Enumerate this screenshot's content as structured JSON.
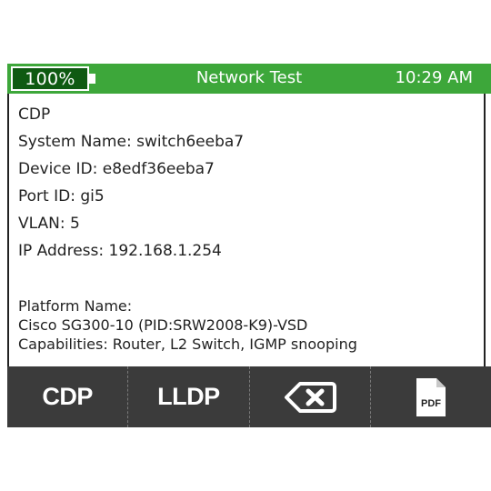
{
  "status_bar": {
    "battery": "100%",
    "title": "Network Test",
    "time": "10:29 AM"
  },
  "details": {
    "heading": "CDP",
    "system_name": "System Name: switch6eeba7",
    "device_id": "Device ID: e8edf36eeba7",
    "port_id": "Port ID: gi5",
    "vlan": "VLAN: 5",
    "ip_address": "IP Address: 192.168.1.254",
    "platform_label": "Platform Name:",
    "platform_value": "Cisco SG300-10 (PID:SRW2008-K9)-VSD",
    "capabilities": "Capabilities: Router, L2 Switch, IGMP snooping"
  },
  "softkeys": {
    "cdp": "CDP",
    "lldp": "LLDP",
    "backspace_icon": "backspace-icon",
    "pdf_icon": "pdf-icon",
    "pdf_text": "PDF"
  },
  "colors": {
    "status_green": "#3da73a",
    "battery_dark_green": "#0f5a12",
    "softkey_bar": "#3b3b3b"
  }
}
